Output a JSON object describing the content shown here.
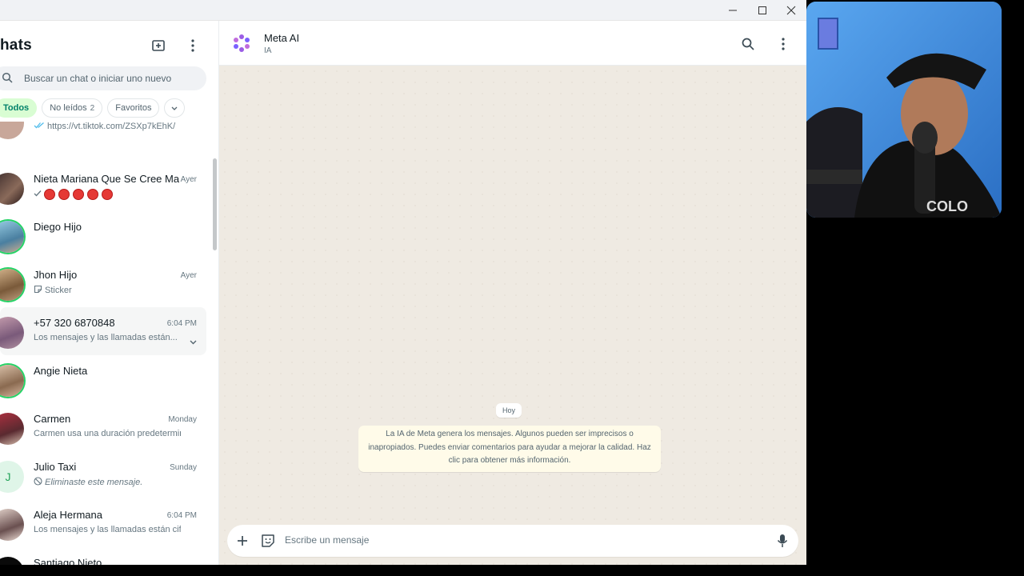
{
  "window": {
    "minimize_icon": "minimize-icon",
    "maximize_icon": "maximize-icon",
    "close_icon": "close-icon"
  },
  "sidebar": {
    "title": "hats",
    "search_placeholder": "Buscar un chat o iniciar uno nuevo",
    "filters": [
      {
        "label": "Todos",
        "active": true
      },
      {
        "label": "No leídos",
        "count": "2"
      },
      {
        "label": "Favoritos"
      }
    ],
    "chats": [
      {
        "name": "",
        "time": "",
        "message": "https://vt.tiktok.com/ZSXp7kEhK/",
        "status": "double-check"
      },
      {
        "name": "Nieta Mariana Que Se Cree Ma...",
        "time": "Ayer",
        "message": "",
        "status": "check",
        "emoji_count": 5
      },
      {
        "name": "Diego Hijo",
        "time": "",
        "message": ""
      },
      {
        "name": "Jhon Hijo",
        "time": "Ayer",
        "message": "Sticker",
        "status": "sticker"
      },
      {
        "name": "+57 320 6870848",
        "time": "6:04 PM",
        "message": "Los mensajes y las llamadas están...",
        "highlighted": true
      },
      {
        "name": "Angie Nieta",
        "time": "",
        "message": ""
      },
      {
        "name": "Carmen",
        "time": "Monday",
        "message": "Carmen usa una duración predetermin..."
      },
      {
        "name": "Julio Taxi",
        "time": "Sunday",
        "message": "Eliminaste este mensaje.",
        "status": "deleted",
        "initial": "J"
      },
      {
        "name": "Aleja Hermana",
        "time": "6:04 PM",
        "message": "Los mensajes y las llamadas están cifr..."
      },
      {
        "name": "Santiago Nieto",
        "time": "",
        "message": ""
      }
    ]
  },
  "chat": {
    "name": "Meta AI",
    "subtitle": "IA",
    "day_label": "Hoy",
    "notice": "La IA de Meta genera los mensajes. Algunos pueden ser imprecisos o inapropiados. Puedes enviar comentarios para ayudar a mejorar la calidad. Haz clic para obtener más información.",
    "composer_placeholder": "Escribe un mensaje"
  },
  "colors": {
    "accent": "#25d366",
    "active_chip_bg": "#d9fdd3",
    "chat_bg": "#efeae2",
    "meta_purple": "#9b5de5"
  }
}
